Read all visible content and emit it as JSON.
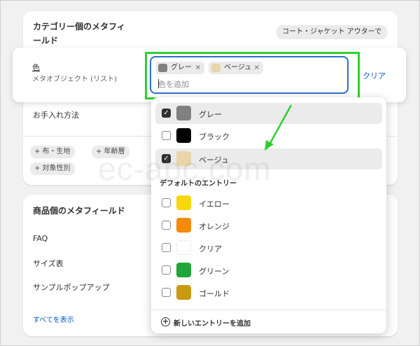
{
  "category_card": {
    "title": "カテゴリー個のメタフィールド",
    "category_chip": "コート・ジャケット アウターで",
    "care_label": "お手入れ方法",
    "filters": [
      "+ 布・生地",
      "+ 年齢層",
      "+ 対象性別"
    ]
  },
  "color_field": {
    "label": "色",
    "type": "メタオブジェクト (リスト)",
    "clear": "クリア",
    "placeholder": "色を追加",
    "tags": [
      {
        "label": "グレー",
        "color": "#808080",
        "remove": "×"
      },
      {
        "label": "ベージュ",
        "color": "#e8d5a8",
        "remove": "×"
      }
    ]
  },
  "dropdown": {
    "selected_options": [
      {
        "label": "グレー",
        "color": "#808080",
        "checked": true
      },
      {
        "label": "ブラック",
        "color": "#000000",
        "checked": false
      },
      {
        "label": "ベージュ",
        "color": "#e8d5a8",
        "checked": true
      }
    ],
    "section_title": "デフォルトのエントリー",
    "default_options": [
      {
        "label": "イエロー",
        "color": "#f7d80f",
        "checked": false
      },
      {
        "label": "オレンジ",
        "color": "#f58a0b",
        "checked": false
      },
      {
        "label": "クリア",
        "color": "#ffffff",
        "checked": false
      },
      {
        "label": "グリーン",
        "color": "#1fa53a",
        "checked": false
      },
      {
        "label": "ゴールド",
        "color": "#c99a14",
        "checked": false
      }
    ],
    "add_entry": "新しいエントリーを追加"
  },
  "product_card": {
    "title": "商品個のメタフィールド",
    "rows": [
      "FAQ",
      "サイズ表",
      "サンプルポップアップ"
    ],
    "see_all": "すべてを表示"
  },
  "watermark": "ec-abc.com",
  "colors": {
    "highlight": "#2ed12e",
    "accent": "#005bd3",
    "focus": "#2c6ecb"
  }
}
